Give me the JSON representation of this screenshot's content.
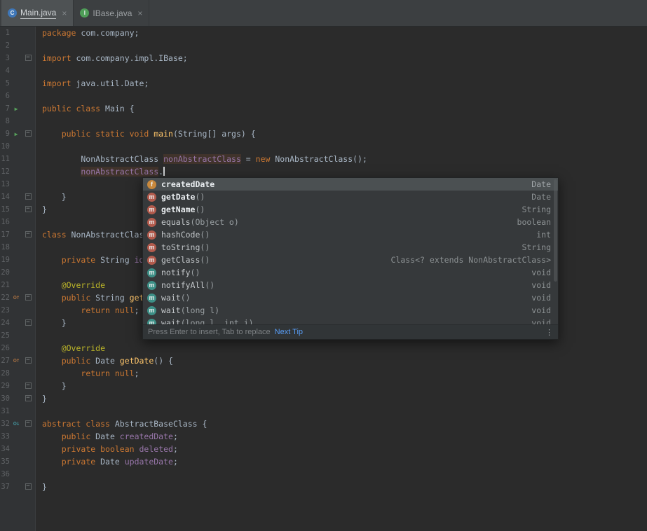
{
  "tabs": [
    {
      "label": "Main.java",
      "kind": "class",
      "active": true
    },
    {
      "label": "IBase.java",
      "kind": "interface",
      "active": false
    }
  ],
  "icons": {
    "close": "×",
    "run": "▶",
    "override": "o↑",
    "implement": "o↓",
    "field": "f",
    "method": "m",
    "more": "⋮",
    "fold": "−",
    "class": "C",
    "interface": "I"
  },
  "editor": {
    "caret_line": 12,
    "gutter_icons": [
      {
        "line": 7,
        "type": "run"
      },
      {
        "line": 9,
        "type": "run"
      },
      {
        "line": 22,
        "type": "override"
      },
      {
        "line": 27,
        "type": "override"
      },
      {
        "line": 32,
        "type": "implement"
      }
    ],
    "fold_markers": [
      3,
      9,
      14,
      15,
      17,
      22,
      24,
      27,
      29,
      30,
      32,
      37
    ],
    "lines": [
      [
        [
          "k",
          "package"
        ],
        [
          "p",
          " com.company;"
        ]
      ],
      [],
      [
        [
          "k",
          "import"
        ],
        [
          "p",
          " com.company.impl.IBase;"
        ]
      ],
      [],
      [
        [
          "k",
          "import"
        ],
        [
          "p",
          " java.util.Date;"
        ]
      ],
      [],
      [
        [
          "k",
          "public class"
        ],
        [
          "p",
          " Main {"
        ]
      ],
      [],
      [
        [
          "p",
          "    "
        ],
        [
          "k",
          "public static void"
        ],
        [
          "p",
          " "
        ],
        [
          "m",
          "main"
        ],
        [
          "p",
          "(String[] args) {"
        ]
      ],
      [],
      [
        [
          "p",
          "        NonAbstractClass "
        ],
        [
          "h",
          "nonAbstractClass"
        ],
        [
          "p",
          " = "
        ],
        [
          "k",
          "new"
        ],
        [
          "p",
          " NonAbstractClass();"
        ]
      ],
      [
        [
          "p",
          "        "
        ],
        [
          "h",
          "nonAbstractClass"
        ],
        [
          "p",
          "."
        ]
      ],
      [],
      [
        [
          "p",
          "    }"
        ]
      ],
      [
        [
          "p",
          "}"
        ]
      ],
      [],
      [
        [
          "k",
          "class"
        ],
        [
          "p",
          " NonAbstractClas"
        ]
      ],
      [],
      [
        [
          "p",
          "    "
        ],
        [
          "k",
          "private"
        ],
        [
          "p",
          " String "
        ],
        [
          "f",
          "id"
        ]
      ],
      [],
      [
        [
          "p",
          "    "
        ],
        [
          "a",
          "@Override"
        ]
      ],
      [
        [
          "p",
          "    "
        ],
        [
          "k",
          "public"
        ],
        [
          "p",
          " String "
        ],
        [
          "m",
          "get"
        ]
      ],
      [
        [
          "p",
          "        "
        ],
        [
          "k",
          "return null"
        ],
        [
          "p",
          ";"
        ]
      ],
      [
        [
          "p",
          "    }"
        ]
      ],
      [],
      [
        [
          "p",
          "    "
        ],
        [
          "a",
          "@Override"
        ]
      ],
      [
        [
          "p",
          "    "
        ],
        [
          "k",
          "public"
        ],
        [
          "p",
          " Date "
        ],
        [
          "m",
          "getDate"
        ],
        [
          "p",
          "() {"
        ]
      ],
      [
        [
          "p",
          "        "
        ],
        [
          "k",
          "return null"
        ],
        [
          "p",
          ";"
        ]
      ],
      [
        [
          "p",
          "    }"
        ]
      ],
      [
        [
          "p",
          "}"
        ]
      ],
      [],
      [
        [
          "k",
          "abstract class"
        ],
        [
          "p",
          " AbstractBaseClass {"
        ]
      ],
      [
        [
          "p",
          "    "
        ],
        [
          "k",
          "public"
        ],
        [
          "p",
          " Date "
        ],
        [
          "f",
          "createdDate"
        ],
        [
          "p",
          ";"
        ]
      ],
      [
        [
          "p",
          "    "
        ],
        [
          "k",
          "private boolean"
        ],
        [
          "p",
          " "
        ],
        [
          "f",
          "deleted"
        ],
        [
          "p",
          ";"
        ]
      ],
      [
        [
          "p",
          "    "
        ],
        [
          "k",
          "private"
        ],
        [
          "p",
          " Date "
        ],
        [
          "f",
          "updateDate"
        ],
        [
          "p",
          ";"
        ]
      ],
      [],
      [
        [
          "p",
          "}"
        ]
      ]
    ]
  },
  "completion": {
    "items": [
      {
        "kind": "field",
        "name": "createdDate",
        "params": "",
        "type": "Date",
        "selected": true,
        "bold": true
      },
      {
        "kind": "method",
        "name": "getDate",
        "params": "()",
        "type": "Date",
        "bold": true
      },
      {
        "kind": "method",
        "name": "getName",
        "params": "()",
        "type": "String",
        "bold": true
      },
      {
        "kind": "method",
        "name": "equals",
        "params": "(Object o)",
        "type": "boolean"
      },
      {
        "kind": "method",
        "name": "hashCode",
        "params": "()",
        "type": "int"
      },
      {
        "kind": "method",
        "name": "toString",
        "params": "()",
        "type": "String"
      },
      {
        "kind": "method",
        "name": "getClass",
        "params": "()",
        "type": "Class<? extends NonAbstractClass>"
      },
      {
        "kind": "final-method",
        "name": "notify",
        "params": "()",
        "type": "void"
      },
      {
        "kind": "final-method",
        "name": "notifyAll",
        "params": "()",
        "type": "void"
      },
      {
        "kind": "final-method",
        "name": "wait",
        "params": "()",
        "type": "void"
      },
      {
        "kind": "final-method",
        "name": "wait",
        "params": "(long l)",
        "type": "void"
      },
      {
        "kind": "final-method",
        "name": "wait",
        "params": "(long l, int i)",
        "type": "void"
      }
    ],
    "hint": "Press Enter to insert, Tab to replace",
    "hint_link": "Next Tip"
  },
  "colors": {
    "background": "#2b2b2b",
    "gutter": "#313335",
    "tabbar": "#3c3f41",
    "keyword": "#cc7832",
    "plain": "#a9b7c6",
    "field": "#9876aa",
    "method": "#ffc66b",
    "annotation": "#bbb529",
    "identifier_highlight": "#40332b",
    "popup_selection": "#4b5052",
    "link": "#589df6"
  }
}
